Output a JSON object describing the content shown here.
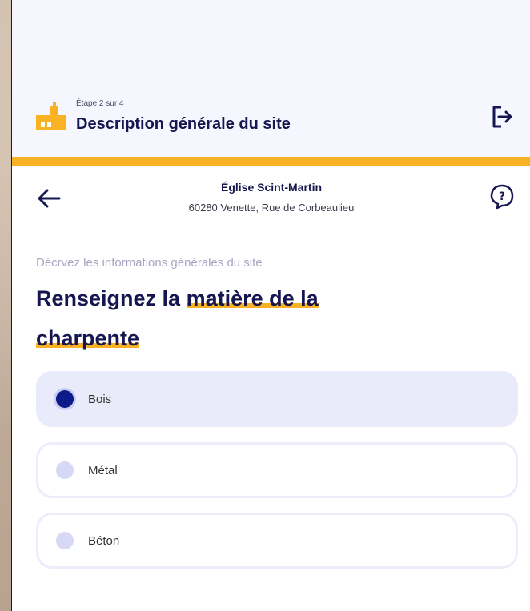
{
  "header": {
    "step": "Étape 2 sur 4",
    "title": "Description générale du site"
  },
  "site": {
    "name": "Église Scint-Martin",
    "address": "60280 Venette, Rue de Corbeaulieu"
  },
  "form": {
    "subtitle": "Décrvez les informations générales du site",
    "question_part1": "Renseignez la ",
    "question_highlight1": "matière de la",
    "question_highlight2": "charpente",
    "options": [
      {
        "label": "Bois",
        "selected": true
      },
      {
        "label": "Métal",
        "selected": false
      },
      {
        "label": "Béton",
        "selected": false
      }
    ]
  },
  "colors": {
    "accent": "#f9b223",
    "brand_navy": "#161650",
    "selected_fill": "#eaebfa"
  },
  "icons": {
    "header": "church-icon",
    "logout": "logout-icon",
    "back": "arrow-left-icon",
    "help": "help-icon"
  }
}
